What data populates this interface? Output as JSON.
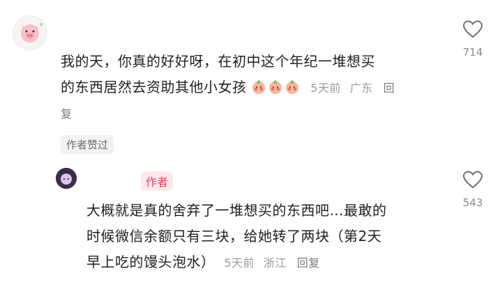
{
  "comment1": {
    "text_line1": "我的天，你真的好好呀，在初中这个年纪一堆想买",
    "text_line2": "的东西居然去资助其他小女孩",
    "emojis": [
      "blushing-peach-emoji",
      "blushing-peach-emoji",
      "blushing-peach-emoji"
    ],
    "time": "5天前",
    "location": "广东",
    "reply_part1": "回",
    "reply_part2": "复",
    "author_liked": "作者赞过",
    "likes": "714"
  },
  "comment2": {
    "badge": "作者",
    "text_line1": "大概就是真的舍弃了一堆想买的东西吧…最敢的",
    "text_line2": "时候微信余额只有三块，给她转了两块（第2天",
    "text_line3": "早上吃的馒头泡水）",
    "time": "5天前",
    "location": "浙江",
    "reply": "回复",
    "likes": "543"
  },
  "colors": {
    "author_badge": "#e0455e",
    "meta": "#9a9a9a",
    "text": "#1f1f1f"
  }
}
